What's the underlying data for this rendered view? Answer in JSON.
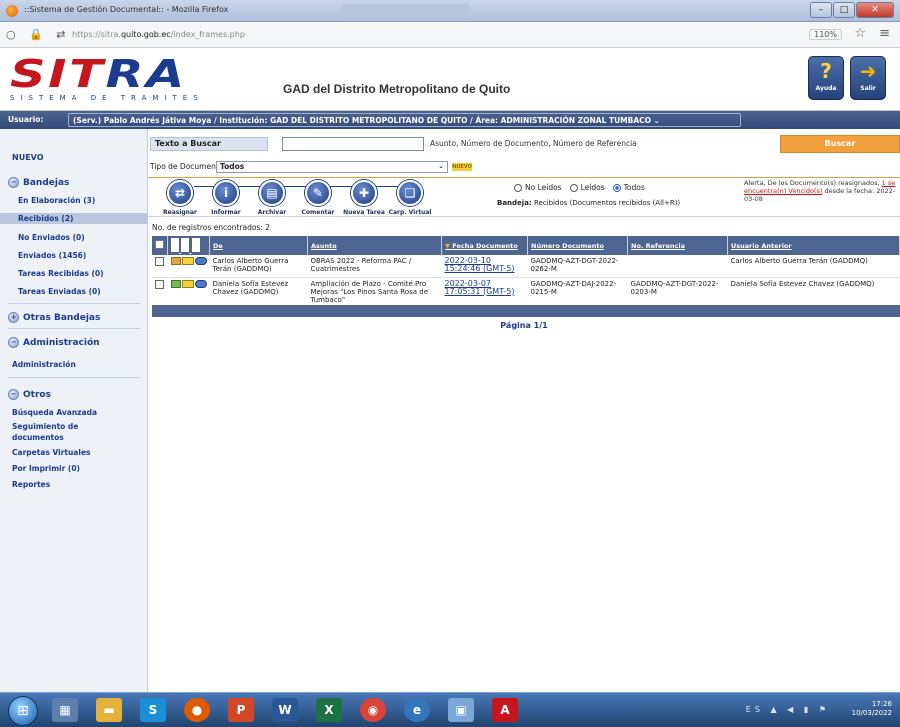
{
  "browser": {
    "window_title": "::Sistema de Gestión Documental:: - Mozilla Firefox",
    "url_prefix": "https://sitra.",
    "url_domain": "quito.gob.ec",
    "url_path": "/index_frames.php",
    "zoom": "110%"
  },
  "header": {
    "logo_red": "SIT",
    "logo_blue": "RA",
    "logo_subtitle": "SISTEMA DE TRAMITES",
    "organization": "GAD del Distrito Metropolitano de Quito",
    "help_label": "Ayuda",
    "exit_label": "Salir"
  },
  "userbar": {
    "label": "Usuario:",
    "value": "(Serv.) Pablo Andrés Játiva Moya / Institución: GAD DEL DISTRITO METROPOLITANO DE QUITO / Área: ADMINISTRACIÓN ZONAL TUMBACO"
  },
  "sidebar": {
    "nuevo": "NUEVO",
    "bandejas": "Bandejas",
    "items": [
      "En Elaboración (3)",
      "Recibidos (2)",
      "No Enviados (0)",
      "Enviados (1456)",
      "Tareas Recibidas (0)",
      "Tareas Enviadas (0)"
    ],
    "otras_bandejas": "Otras Bandejas",
    "administracion": "Administración",
    "administracion_item": "Administración",
    "otros": "Otros",
    "otros_items": [
      "Búsqueda Avanzada",
      "Seguimiento de documentos",
      "Carpetas Virtuales",
      "Por Imprimir (0)",
      "Reportes"
    ]
  },
  "search": {
    "label": "Texto a Buscar",
    "value": "",
    "hint": "Asunto, Número de Documento, Número de Referencia",
    "button": "Buscar"
  },
  "doc_type": {
    "label": "Tipo de Documento:",
    "selected": "Todos",
    "badge": "NUEVO"
  },
  "toolbar": [
    {
      "label": "Reasignar",
      "icon": "reassign-icon",
      "glyph": "⇄"
    },
    {
      "label": "Informar",
      "icon": "info-icon",
      "glyph": "i"
    },
    {
      "label": "Archivar",
      "icon": "archive-icon",
      "glyph": "▤"
    },
    {
      "label": "Comentar",
      "icon": "comment-icon",
      "glyph": "✎"
    },
    {
      "label": "Nueva Tarea",
      "icon": "new-task-icon",
      "glyph": "✚"
    },
    {
      "label": "Carp. Virtual",
      "icon": "virtual-folder-icon",
      "glyph": "❏"
    }
  ],
  "filter": {
    "options": [
      "No Leídos",
      "Leídos",
      "Todos"
    ],
    "selected": "Todos",
    "bandeja_label": "Bandeja:",
    "bandeja_value": "Recibidos (Documentos recibidos (All+R))"
  },
  "alert": {
    "text_before": "Alerta, De los Documento(s) reasignados, ",
    "red_text": "1 se encuentra(n) Vencido(s)",
    "text_after": " desde la fecha: 2022-03-08"
  },
  "records_count": "No. de registros encontrados: 2",
  "table": {
    "columns": [
      "De",
      "Asunto",
      "Fecha Documento",
      "Número Documento",
      "No. Referencia",
      "Usuario Anterior"
    ],
    "rows": [
      {
        "de": "Carlos Alberto Guerra Terán (GADDMQ)",
        "asunto": "OBRAS 2022 - Reforma PAC / Cuatrimestres",
        "fecha": "2022-03-10",
        "hora": "15:24:46 (GMT-5)",
        "numero": "GADDMQ-AZT-DGT-2022-0262-M",
        "referencia": "",
        "usuario_anterior": "Carlos Alberto Guerra Terán (GADDMQ)"
      },
      {
        "de": "Daniela Sofía Estevez Chavez (GADDMQ)",
        "asunto": "Ampliación de Plazo - Comité Pro Mejoras \"Los Pinos Santa Rosa de Tumbaco\"",
        "fecha": "2022-03-07",
        "hora": "17:05:31 (GMT-5)",
        "numero": "GADDMQ-AZT-DAJ-2022-0215-M",
        "referencia": "GADDMQ-AZT-DGT-2022-0203-M",
        "usuario_anterior": "Daniela Sofía Estevez Chavez (GADDMQ)"
      }
    ]
  },
  "pager": "Página 1/1",
  "taskbar": {
    "language": "ES",
    "time": "17:26",
    "date": "10/03/2022"
  }
}
